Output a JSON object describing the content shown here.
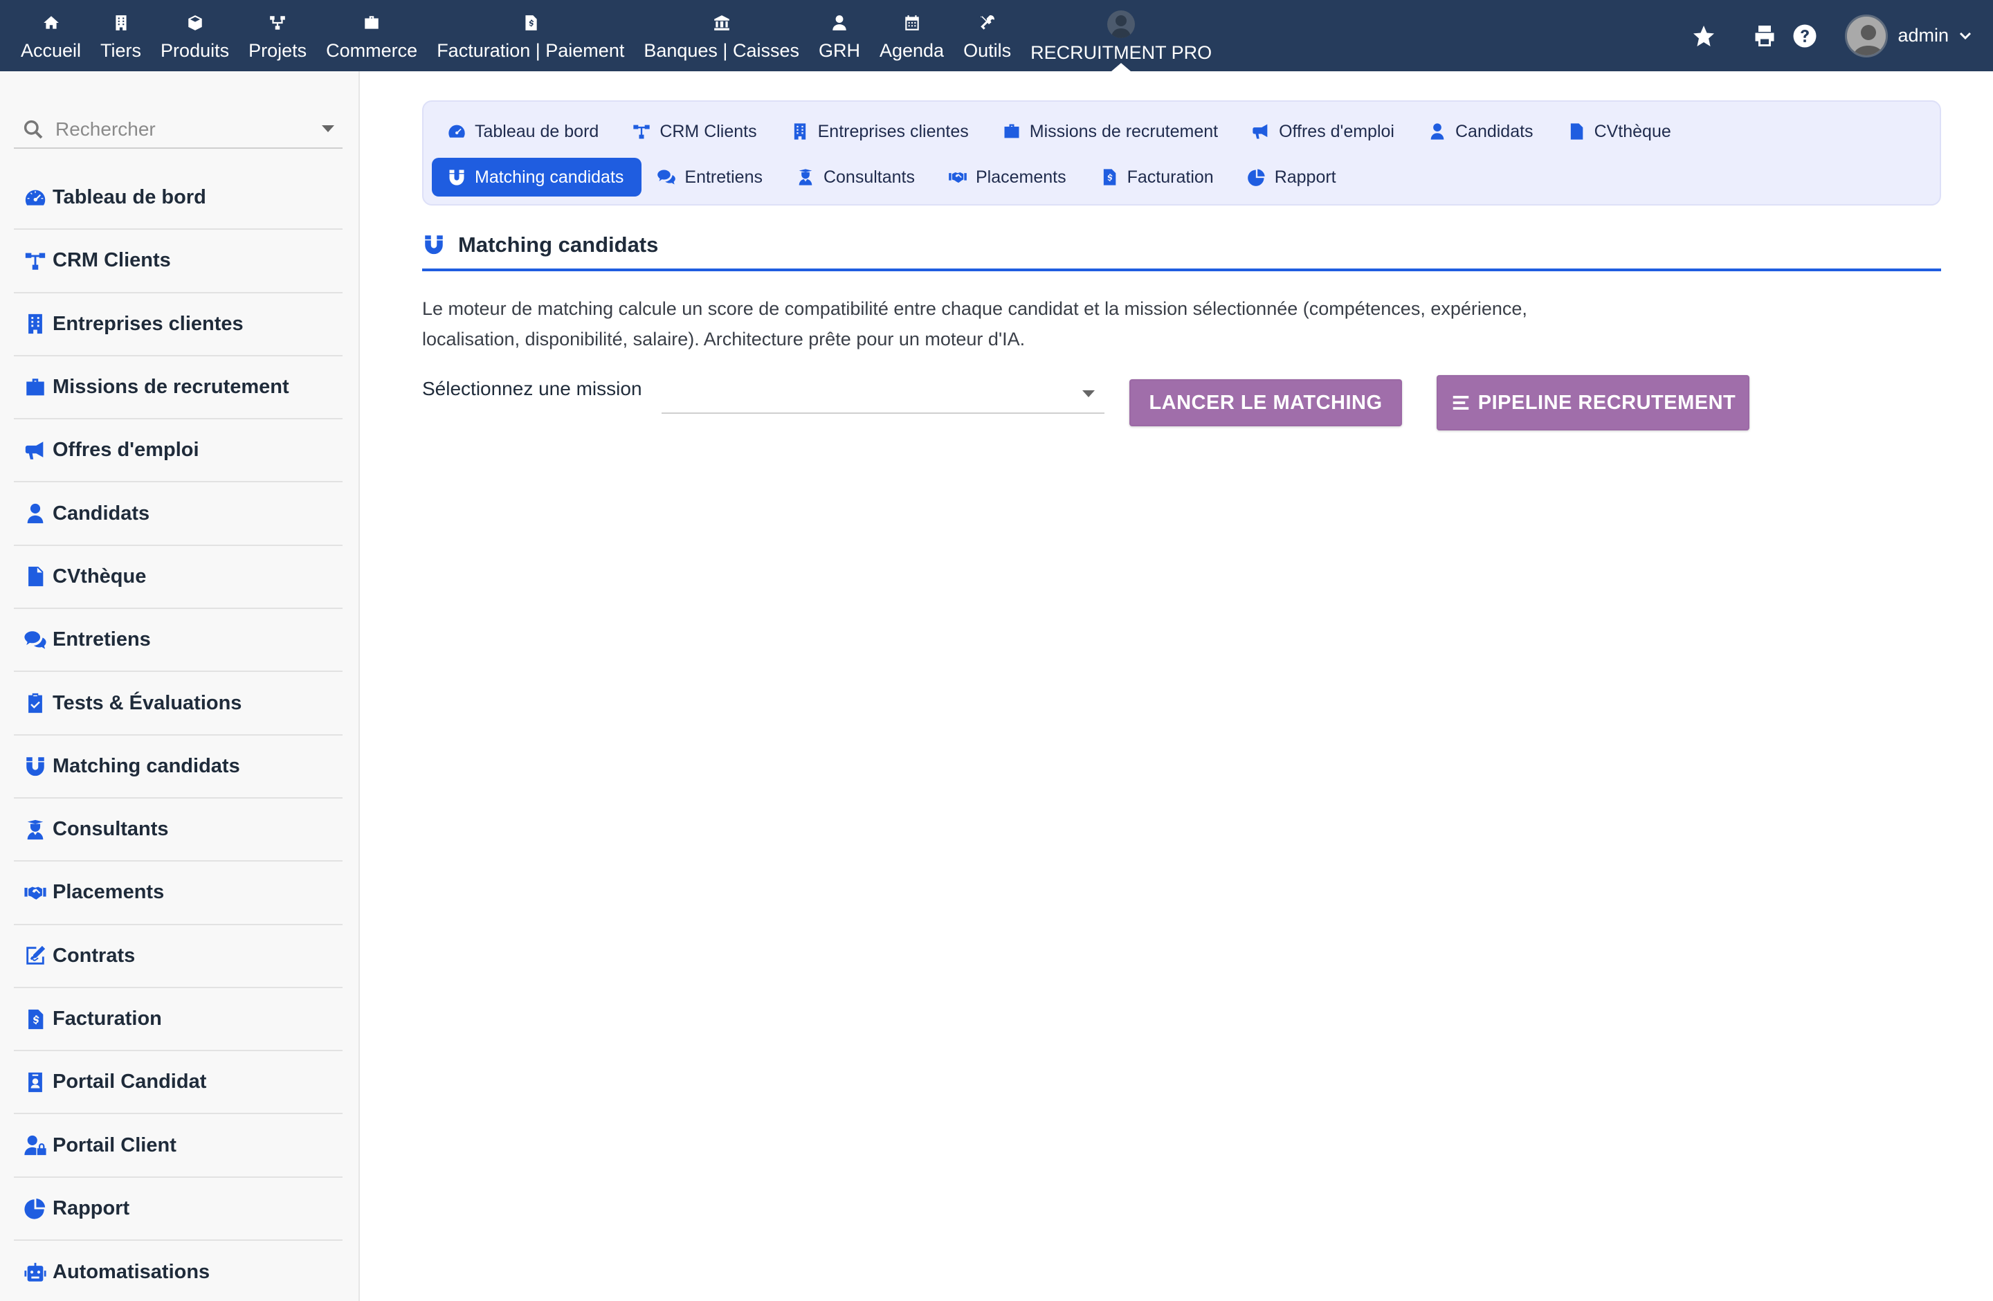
{
  "topnav": {
    "items": [
      {
        "label": "Accueil",
        "icon": "home-icon"
      },
      {
        "label": "Tiers",
        "icon": "building-icon"
      },
      {
        "label": "Produits",
        "icon": "cube-icon"
      },
      {
        "label": "Projets",
        "icon": "sitemap-icon"
      },
      {
        "label": "Commerce",
        "icon": "briefcase-icon"
      },
      {
        "label": "Facturation | Paiement",
        "icon": "invoice-icon"
      },
      {
        "label": "Banques | Caisses",
        "icon": "bank-icon"
      },
      {
        "label": "GRH",
        "icon": "user-icon"
      },
      {
        "label": "Agenda",
        "icon": "calendar-icon"
      },
      {
        "label": "Outils",
        "icon": "tools-icon"
      },
      {
        "label": "RECRUITMENT PRO",
        "icon": "avatar-icon",
        "active": true
      }
    ],
    "user": "admin"
  },
  "sidebar": {
    "search_placeholder": "Rechercher",
    "items": [
      {
        "label": "Tableau de bord",
        "icon": "dashboard-icon"
      },
      {
        "label": "CRM Clients",
        "icon": "sitemap-icon"
      },
      {
        "label": "Entreprises clientes",
        "icon": "building-icon"
      },
      {
        "label": "Missions de recrutement",
        "icon": "briefcase-icon"
      },
      {
        "label": "Offres d'emploi",
        "icon": "megaphone-icon"
      },
      {
        "label": "Candidats",
        "icon": "user-icon"
      },
      {
        "label": "CVthèque",
        "icon": "file-icon"
      },
      {
        "label": "Entretiens",
        "icon": "comments-icon"
      },
      {
        "label": "Tests & Évaluations",
        "icon": "clipboard-check-icon"
      },
      {
        "label": "Matching candidats",
        "icon": "magnet-icon"
      },
      {
        "label": "Consultants",
        "icon": "user-tie-icon"
      },
      {
        "label": "Placements",
        "icon": "handshake-icon"
      },
      {
        "label": "Contrats",
        "icon": "signature-icon"
      },
      {
        "label": "Facturation",
        "icon": "invoice-icon"
      },
      {
        "label": "Portail Candidat",
        "icon": "id-badge-icon"
      },
      {
        "label": "Portail Client",
        "icon": "user-lock-icon"
      },
      {
        "label": "Rapport",
        "icon": "chart-pie-icon"
      },
      {
        "label": "Automatisations",
        "icon": "robot-icon"
      }
    ]
  },
  "tabs": {
    "row1": [
      {
        "label": "Tableau de bord",
        "icon": "dashboard-icon"
      },
      {
        "label": "CRM Clients",
        "icon": "sitemap-icon"
      },
      {
        "label": "Entreprises clientes",
        "icon": "building-icon"
      },
      {
        "label": "Missions de recrutement",
        "icon": "briefcase-icon"
      },
      {
        "label": "Offres d'emploi",
        "icon": "megaphone-icon"
      },
      {
        "label": "Candidats",
        "icon": "user-icon"
      },
      {
        "label": "CVthèque",
        "icon": "file-icon"
      }
    ],
    "row2": [
      {
        "label": "Matching candidats",
        "icon": "magnet-icon",
        "active": true
      },
      {
        "label": "Entretiens",
        "icon": "comments-icon"
      },
      {
        "label": "Consultants",
        "icon": "user-tie-icon"
      },
      {
        "label": "Placements",
        "icon": "handshake-icon"
      },
      {
        "label": "Facturation",
        "icon": "invoice-icon"
      },
      {
        "label": "Rapport",
        "icon": "chart-pie-icon"
      }
    ]
  },
  "main": {
    "title": "Matching candidats",
    "description_line1": "Le moteur de matching calcule un score de compatibilité entre chaque candidat et la mission sélectionnée (compétences, expérience,",
    "description_line2": "localisation, disponibilité, salaire). Architecture prête pour un moteur d'IA.",
    "mission_label": "Sélectionnez une mission",
    "mission_value": "",
    "launch_button": "LANCER LE MATCHING",
    "pipeline_button": "PIPELINE RECRUTEMENT"
  },
  "colors": {
    "topbar": "#263c5c",
    "accent": "#1f5de0",
    "button_purple": "#a06eaa",
    "tabs_bg": "#eceefd"
  }
}
